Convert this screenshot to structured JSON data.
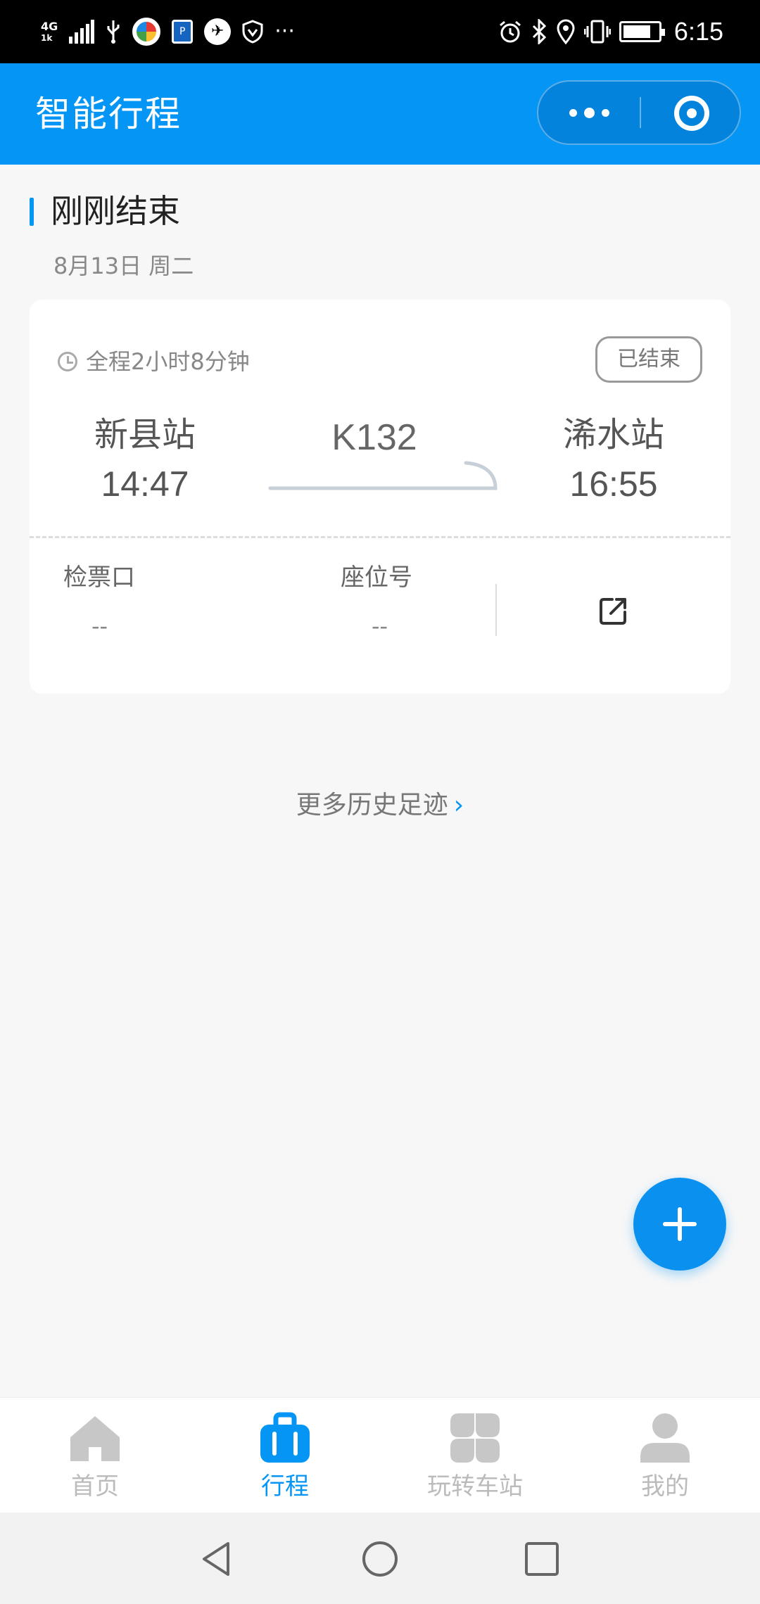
{
  "status_bar": {
    "network": "4G",
    "network_sub": "1k",
    "overflow": "···",
    "time": "6:15"
  },
  "header": {
    "title": "智能行程",
    "capsule": {
      "more_icon": "more-dots-icon",
      "close_icon": "target-icon"
    }
  },
  "section": {
    "title": "刚刚结束",
    "date": "8月13日 周二"
  },
  "trip": {
    "duration": "全程2小时8分钟",
    "status": "已结束",
    "from_station": "新县站",
    "from_time": "14:47",
    "train_no": "K132",
    "to_station": "浠水站",
    "to_time": "16:55",
    "gate_label": "检票口",
    "gate_value": "--",
    "seat_label": "座位号",
    "seat_value": "--"
  },
  "history_link": {
    "label": "更多历史足迹",
    "chevron": "›"
  },
  "fab": {
    "icon": "plus-icon"
  },
  "tabbar": {
    "tabs": [
      {
        "label": "首页",
        "icon": "home-icon",
        "active": false
      },
      {
        "label": "行程",
        "icon": "luggage-icon",
        "active": true
      },
      {
        "label": "玩转车站",
        "icon": "grid-icon",
        "active": false
      },
      {
        "label": "我的",
        "icon": "person-icon",
        "active": false
      }
    ]
  },
  "colors": {
    "brand": "#0596f5",
    "inactive": "#bbbbbb"
  }
}
